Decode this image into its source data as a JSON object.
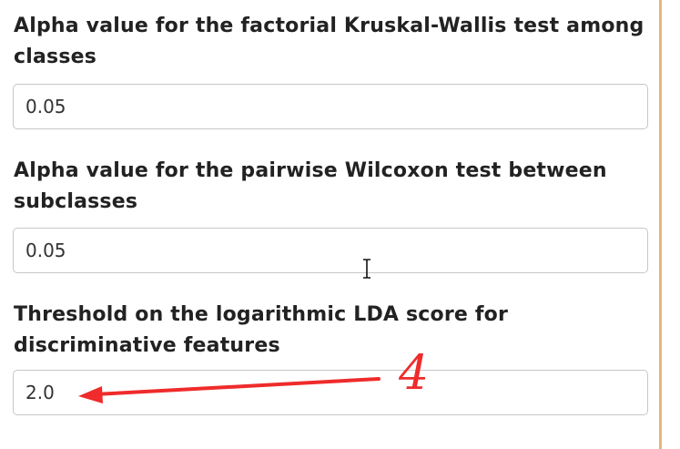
{
  "fields": [
    {
      "label": "Alpha value for the factorial Kruskal-Wallis test among classes",
      "value": "0.05"
    },
    {
      "label": "Alpha value for the pairwise Wilcoxon test between subclasses",
      "value": "0.05"
    },
    {
      "label": "Threshold on the logarithmic LDA score for discriminative features",
      "value": "2.0"
    }
  ],
  "annotation": {
    "number": "4",
    "color": "#ef2b2b"
  },
  "cursor": {
    "icon": "text-cursor-icon"
  },
  "colors": {
    "right_border": "#e8b47a",
    "label_text": "#222222",
    "input_border": "#c7c7c7"
  }
}
